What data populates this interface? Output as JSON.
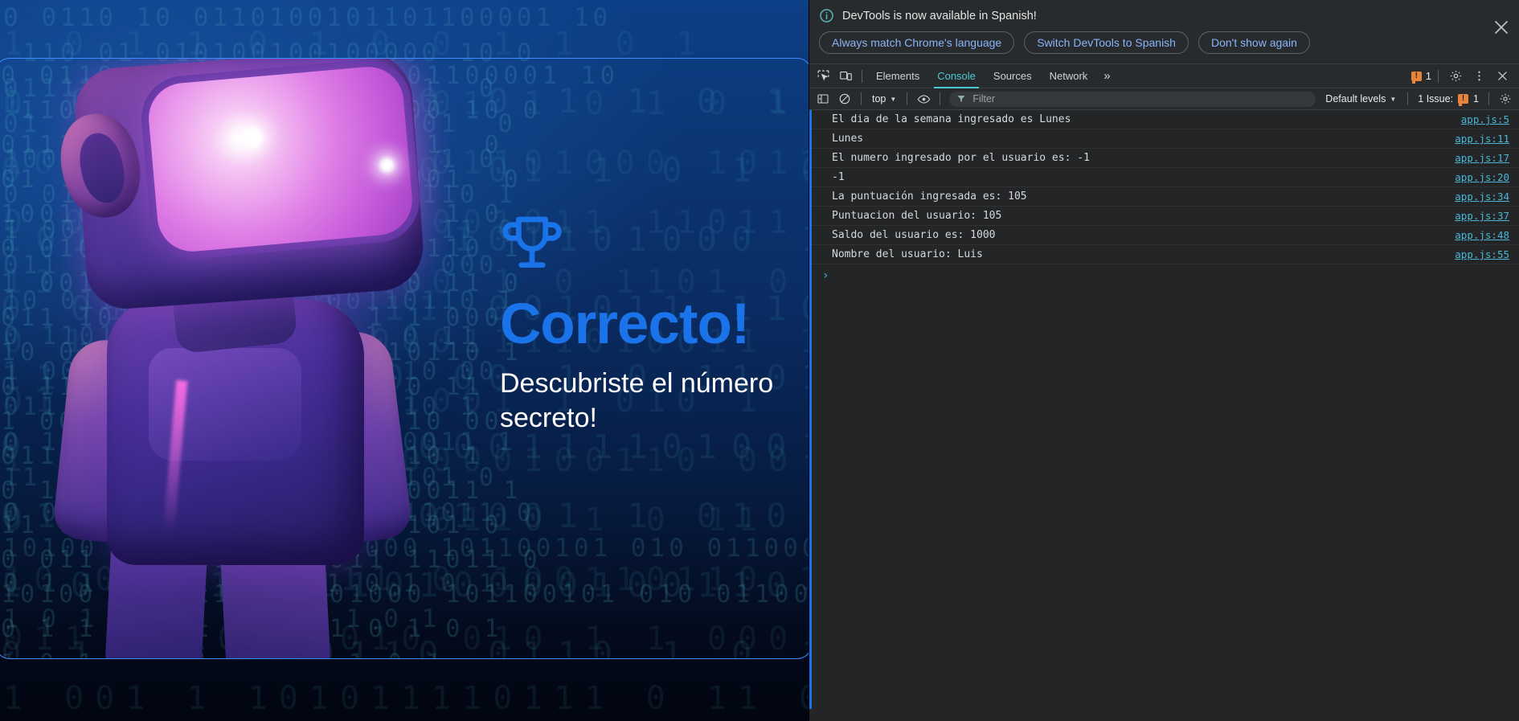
{
  "page": {
    "result": {
      "trophy_icon": "trophy-icon",
      "headline": "Correcto!",
      "subline": "Descubriste el número secreto!",
      "headline_color": "#1a73e8",
      "subline_color": "#ffffff"
    },
    "background": {
      "binary_rows": [
        "0 0110 10 0110100101101100001 10",
        " 110 01 010100100100000 10 0",
        "011111  101101000010  1  0",
        "01  11011  1  0010 01001  0",
        "1001011 1001 11 1 1101 1 0",
        "0 0100 0111111010 1 00110 1",
        "1 001 1 101011110111 0 11 0",
        "011 1010100010 010 1 1 000",
        "10 011 100 11 0 100110110 1",
        "0 1101 1 0110 0110 1 0 11",
        "1 000 1 011010000100110 00",
        "011 11 0101101001 1 010 1",
        "0 1 1 0011000001111010011 1",
        "11 011000010 00 1 0 1101 0",
        "0 011 10 0 11 001011 11011 0",
        "10100 010 11 101101000 101100101 010 011000",
        "0 1 1 0 1 1 0 01 1 0 1 0 1",
        "1 0 1 1 0 1 0 0 1 1 0 1"
      ]
    }
  },
  "devtools": {
    "infobar": {
      "message": "DevTools is now available in Spanish!",
      "info_icon": "info-circle-icon",
      "close_icon": "close-icon",
      "buttons": [
        "Always match Chrome's language",
        "Switch DevTools to Spanish",
        "Don't show again"
      ]
    },
    "tabstrip": {
      "inspect_icon": "inspect-element-icon",
      "device_icon": "device-toolbar-icon",
      "tabs": [
        {
          "label": "Elements",
          "active": false
        },
        {
          "label": "Console",
          "active": true
        },
        {
          "label": "Sources",
          "active": false
        },
        {
          "label": "Network",
          "active": false
        }
      ],
      "more_tabs": "»",
      "error_count": "1",
      "settings_icon": "gear-icon",
      "more_icon": "kebab-menu-icon",
      "close_icon": "close-icon"
    },
    "console_toolbar": {
      "sidebar_icon": "console-sidebar-icon",
      "clear_icon": "clear-console-icon",
      "context": "top",
      "eye_icon": "live-expression-icon",
      "filter_icon": "filter-icon",
      "filter_placeholder": "Filter",
      "filter_value": "",
      "levels": "Default levels",
      "issues_label": "1 Issue:",
      "issues_count": "1",
      "settings_icon": "gear-icon"
    },
    "console_messages": [
      {
        "text": "El dia de la semana ingresado es Lunes",
        "source": "app.js:5"
      },
      {
        "text": "Lunes",
        "source": "app.js:11"
      },
      {
        "text": "El numero ingresado por el usuario es: -1",
        "source": "app.js:17"
      },
      {
        "text": "-1",
        "source": "app.js:20"
      },
      {
        "text": "La puntuación ingresada es: 105",
        "source": "app.js:34"
      },
      {
        "text": "Puntuacion del usuario: 105",
        "source": "app.js:37"
      },
      {
        "text": "Saldo del usuario es: 1000",
        "source": "app.js:48"
      },
      {
        "text": "Nombre del usuario: Luis",
        "source": "app.js:55"
      }
    ],
    "prompt": {
      "caret": "›",
      "value": ""
    },
    "colors": {
      "panel_bg": "#232527",
      "toolbar_bg": "#282b2d",
      "accent": "#4ec9d4",
      "link": "#4db6d6",
      "warning": "#e8833a",
      "button_text": "#8ab4f8"
    }
  }
}
